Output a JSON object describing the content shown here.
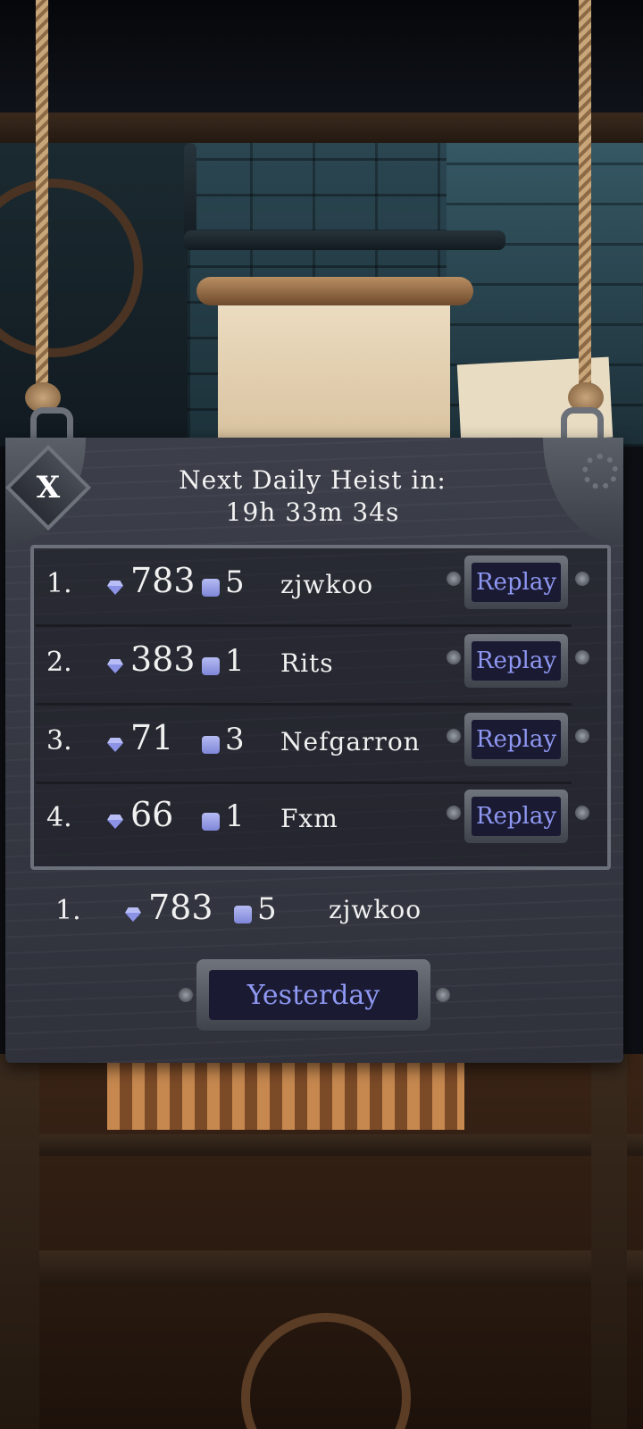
{
  "header": {
    "title_line1": "Next Daily Heist in:",
    "title_line2": "19h 33m 34s",
    "close_label": "X"
  },
  "leaderboard": [
    {
      "rank": "1.",
      "gems": "783",
      "chests": "5",
      "player": "zjwkoo",
      "replay_label": "Replay"
    },
    {
      "rank": "2.",
      "gems": "383",
      "chests": "1",
      "player": "Rits",
      "replay_label": "Replay"
    },
    {
      "rank": "3.",
      "gems": "71",
      "chests": "3",
      "player": "Nefgarron",
      "replay_label": "Replay"
    },
    {
      "rank": "4.",
      "gems": "66",
      "chests": "1",
      "player": "Fxm",
      "replay_label": "Replay"
    }
  ],
  "current_player": {
    "rank": "1.",
    "gems": "783",
    "chests": "5",
    "player": "zjwkoo"
  },
  "footer": {
    "yesterday_label": "Yesterday"
  },
  "icons": {
    "gem": "gem-icon",
    "chest": "chest-icon",
    "close": "close-icon"
  },
  "colors": {
    "accent_text": "#8f98f2",
    "board": "#34363f",
    "text": "#f0f0f0"
  }
}
